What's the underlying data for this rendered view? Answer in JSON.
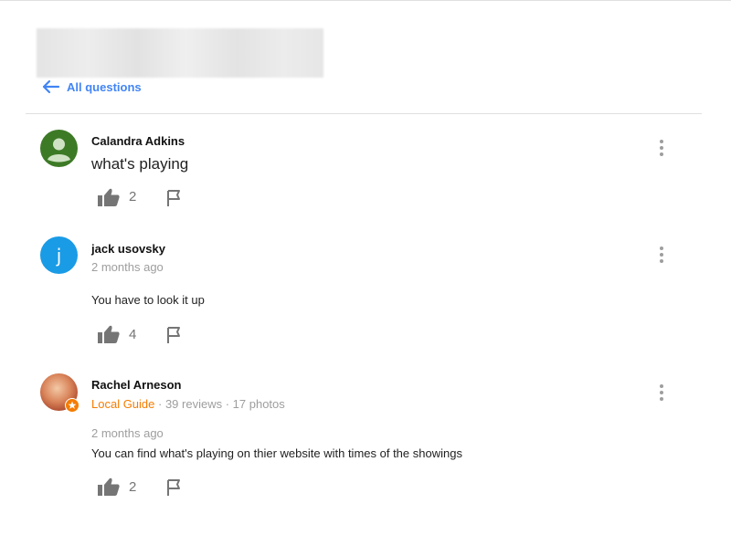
{
  "nav": {
    "back_label": "All questions"
  },
  "question": {
    "author": "Calandra Adkins",
    "text": "what's playing",
    "likes": "2"
  },
  "answers": [
    {
      "author": "jack usovsky",
      "avatar_letter": "j",
      "avatar_color": "#1a9be6",
      "time": "2 months ago",
      "text": "You have to look it up",
      "likes": "4"
    },
    {
      "author": "Rachel Arneson",
      "badge": "Local Guide",
      "reviews": "39 reviews",
      "photos": "17 photos",
      "separator": " · ",
      "time": "2 months ago",
      "text": "You can find what's playing on thier website with times of the showings",
      "likes": "2"
    }
  ],
  "colors": {
    "link": "#4285f4",
    "local_guide": "#f57c00",
    "question_avatar": "#3d7a26"
  },
  "icons": [
    "back-arrow-icon",
    "thumbs-up-icon",
    "flag-icon",
    "more-vert-icon",
    "person-icon",
    "local-guide-star-icon"
  ]
}
